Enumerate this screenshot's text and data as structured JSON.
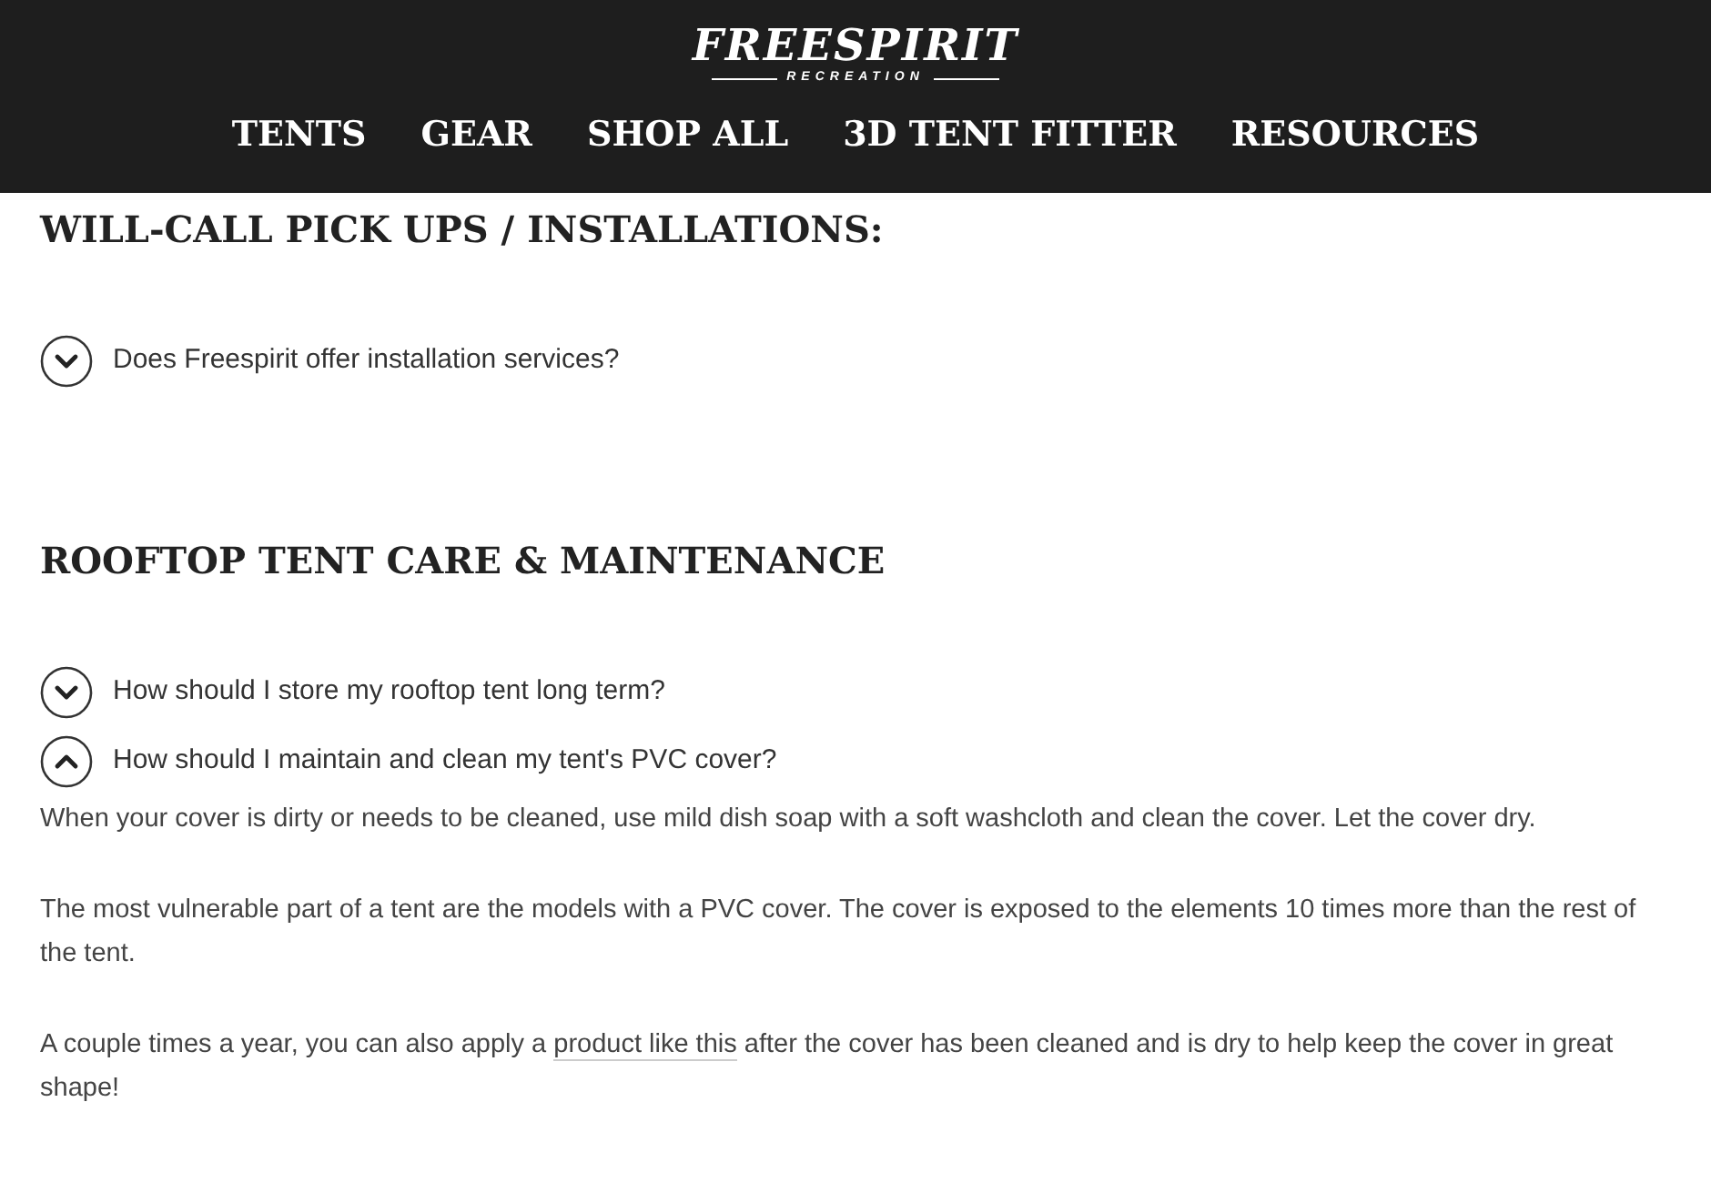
{
  "header": {
    "logo": {
      "name": "FREESPIRIT",
      "tagline": "RECREATION"
    },
    "nav": [
      {
        "label": "TENTS"
      },
      {
        "label": "GEAR"
      },
      {
        "label": "SHOP ALL"
      },
      {
        "label": "3D TENT FITTER"
      },
      {
        "label": "RESOURCES"
      }
    ]
  },
  "sections": [
    {
      "title": "WILL-CALL PICK UPS / INSTALLATIONS:",
      "faqs": [
        {
          "question": "Does Freespirit offer installation services?",
          "expanded": false
        }
      ]
    },
    {
      "title": "ROOFTOP TENT CARE & MAINTENANCE",
      "faqs": [
        {
          "question": "How should I store my rooftop tent long term?",
          "expanded": false
        },
        {
          "question": "How should I maintain and clean my tent's PVC cover?",
          "expanded": true,
          "answer": [
            {
              "text": "When your cover is dirty or needs to be cleaned, use mild dish soap with a soft washcloth and clean the cover. Let the cover dry."
            },
            {
              "text": "The most vulnerable part of a tent are the models with a PVC cover.  The cover is exposed to the elements 10 times more than the rest of the tent."
            },
            {
              "text": "A couple times a year, you can also apply a ",
              "link": "product like this",
              "after": " after the cover has been cleaned and is dry to help keep the cover in great shape!"
            }
          ]
        }
      ]
    }
  ]
}
